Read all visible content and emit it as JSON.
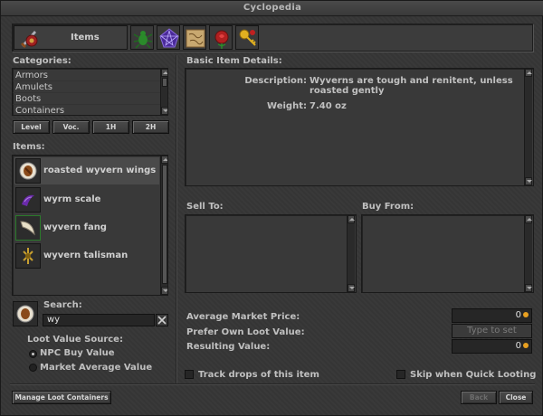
{
  "window": {
    "title": "Cyclopedia"
  },
  "tabs": {
    "active_label": "Items",
    "icons": [
      "sword-shield-icon",
      "bug-icon",
      "pentagram-icon",
      "map-icon",
      "rose-icon",
      "key-icon"
    ]
  },
  "categories": {
    "heading": "Categories:",
    "items": [
      "Armors",
      "Amulets",
      "Boots",
      "Containers"
    ]
  },
  "filters": {
    "level": "Level",
    "voc": "Voc.",
    "one_h": "1H",
    "two_h": "2H"
  },
  "items": {
    "heading": "Items:",
    "list": [
      {
        "name": "roasted wyvern wings",
        "icon": "roasted-wings-icon"
      },
      {
        "name": "wyrm scale",
        "icon": "wyrm-scale-icon"
      },
      {
        "name": "wyvern fang",
        "icon": "wyvern-fang-icon"
      },
      {
        "name": "wyvern talisman",
        "icon": "wyvern-talisman-icon"
      }
    ]
  },
  "search": {
    "label": "Search:",
    "value": "wy"
  },
  "loot_value": {
    "heading": "Loot Value Source:",
    "npc": "NPC Buy Value",
    "market": "Market Average Value",
    "selected": "npc"
  },
  "manage_button": "Manage Loot Containers",
  "details": {
    "heading": "Basic Item Details:",
    "description_label": "Description:",
    "description": "Wyverns are tough and renitent, unless roasted gently",
    "weight_label": "Weight:",
    "weight": "7.40 oz"
  },
  "sell_to": "Sell To:",
  "buy_from": "Buy From:",
  "prices": {
    "avg_label": "Average Market Price:",
    "avg_value": "0",
    "prefer_label": "Prefer Own Loot Value:",
    "prefer_placeholder": "Type to set",
    "result_label": "Resulting Value:",
    "result_value": "0"
  },
  "options": {
    "track": "Track drops of this item",
    "skip": "Skip when Quick Looting"
  },
  "footer": {
    "back": "Back",
    "close": "Close"
  },
  "colors": {
    "gold": "#e8a020"
  }
}
